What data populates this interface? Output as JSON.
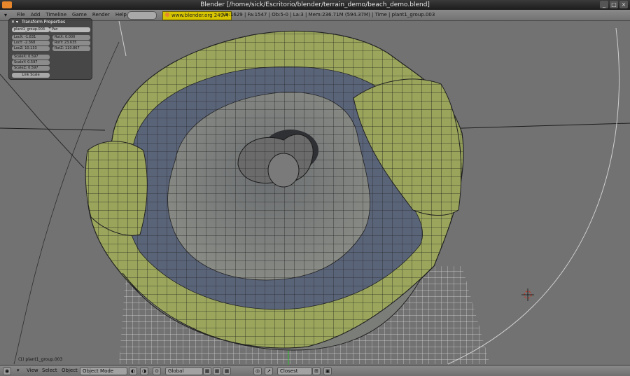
{
  "window": {
    "title": "Blender [/home/sick/Escritorio/blender/terrain_demo/beach_demo.blend]",
    "buttons": [
      "_",
      "□",
      "×"
    ]
  },
  "info_header": {
    "menus": [
      "File",
      "Add",
      "Timeline",
      "Game",
      "Render",
      "Help"
    ],
    "link": "www.blender.org 249.4",
    "stats": "Ve:1629 | Fa:1547 | Ob:5-0 | La:3 | Mem:236.71M (594.37M) | Time | plant1_group.003"
  },
  "transform_panel": {
    "title": "Transform Properties",
    "object_name": "plant1_group.003",
    "parent": "Par:",
    "loc": [
      "LocX: -1.831",
      "LocY: -2.368",
      "LocZ: 10.133"
    ],
    "rot": [
      "RotX: 0.000",
      "RotY: 23.635",
      "RotZ: 110.867"
    ],
    "scale": [
      "ScaleX: 0.597",
      "ScaleY: 0.597",
      "ScaleZ: 0.597"
    ],
    "link_scale": "Link Scale"
  },
  "viewport": {
    "object_label": "(1) plant1_group.003"
  },
  "bottom_header": {
    "view": "View",
    "select": "Select",
    "object": "Object",
    "mode": "Object Mode",
    "orientation": "Global",
    "proportional": "Closest"
  }
}
